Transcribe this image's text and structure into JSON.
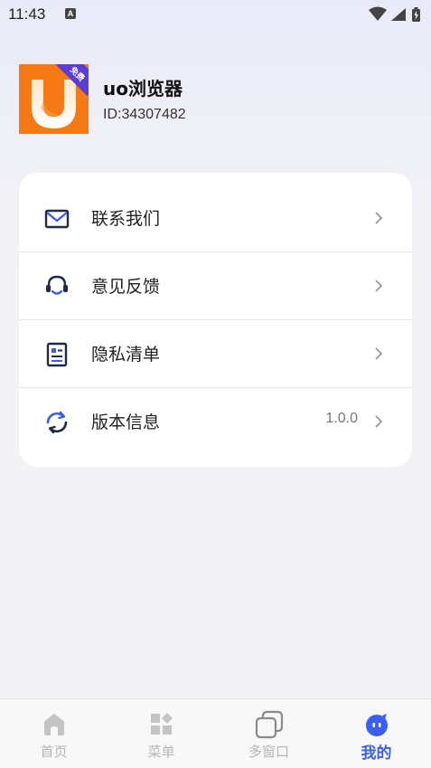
{
  "status_bar": {
    "time": "11:43",
    "notification_icon": "A"
  },
  "profile": {
    "app_name": "uo浏览器",
    "id_text": "ID:34307482",
    "badge_text": "免费"
  },
  "menu": [
    {
      "label": "联系我们",
      "value": "",
      "icon": "mail-icon"
    },
    {
      "label": "意见反馈",
      "value": "",
      "icon": "headset-icon"
    },
    {
      "label": "隐私清单",
      "value": "",
      "icon": "document-list-icon"
    },
    {
      "label": "版本信息",
      "value": "1.0.0",
      "icon": "refresh-icon"
    }
  ],
  "tabs": [
    {
      "label": "首页",
      "icon": "home-icon",
      "active": false
    },
    {
      "label": "菜单",
      "icon": "grid-icon",
      "active": false
    },
    {
      "label": "多窗口",
      "icon": "windows-icon",
      "active": false
    },
    {
      "label": "我的",
      "icon": "profile-face-icon",
      "active": true
    }
  ],
  "colors": {
    "accent": "#3a5ef0",
    "logo_orange": "#f57a16",
    "badge_purple": "#5b3cd6",
    "inactive_tab": "#b5b5b5"
  }
}
